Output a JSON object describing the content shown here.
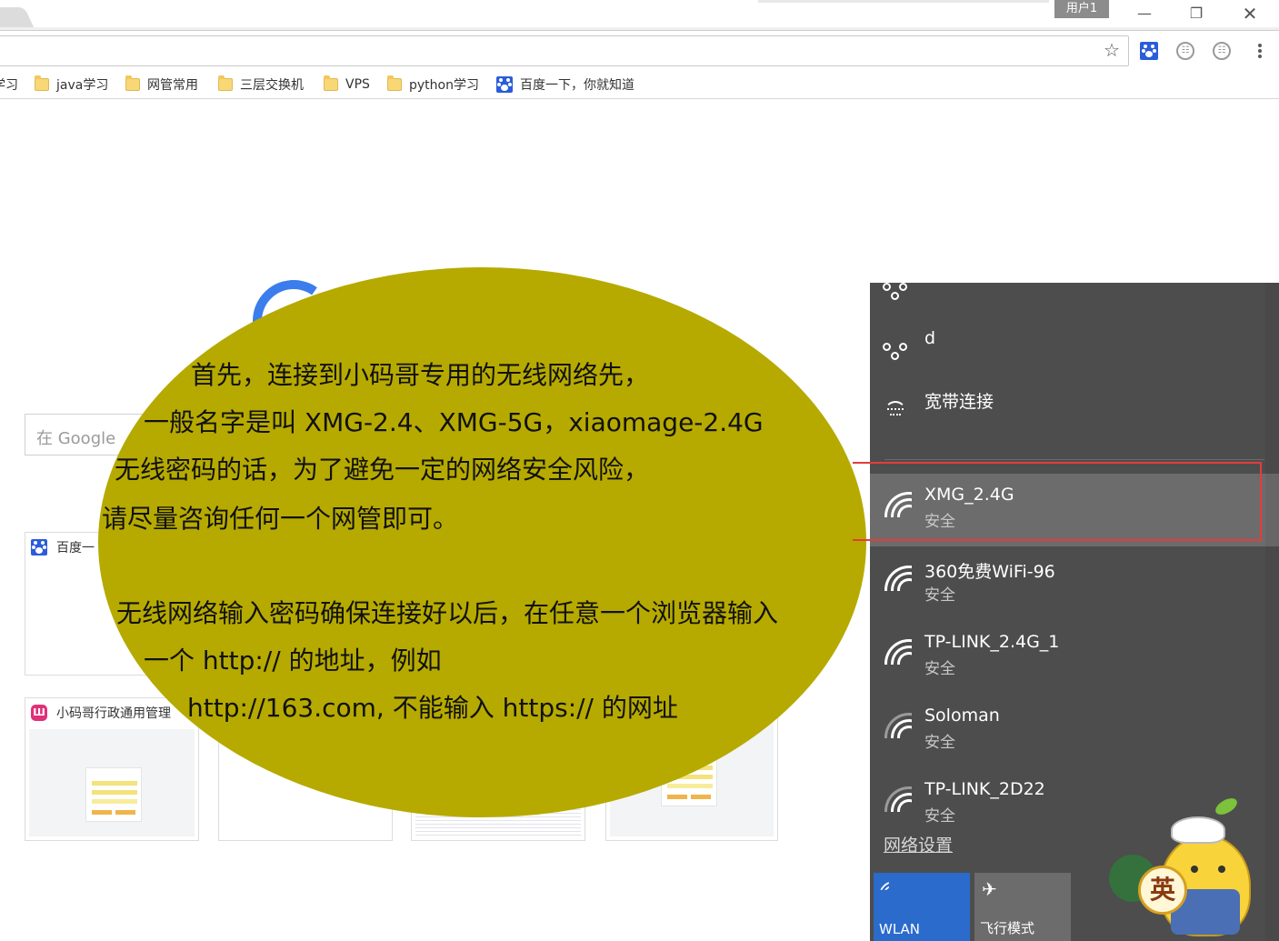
{
  "window": {
    "user_badge": "用户1",
    "min_glyph": "—",
    "max_glyph": "❐",
    "close_glyph": "✕"
  },
  "toolbar": {
    "star_glyph": "☆",
    "ext_circle_glyph": "☷"
  },
  "bookmarks": [
    {
      "label": "学习",
      "icon": "folder-icon"
    },
    {
      "label": "java学习",
      "icon": "folder-icon"
    },
    {
      "label": "网管常用",
      "icon": "folder-icon"
    },
    {
      "label": "三层交换机",
      "icon": "folder-icon"
    },
    {
      "label": "VPS",
      "icon": "folder-icon"
    },
    {
      "label": "python学习",
      "icon": "folder-icon"
    },
    {
      "label": "百度一下，你就知道",
      "icon": "baidu-paw-icon"
    }
  ],
  "newtab": {
    "search_placeholder": "在 Google",
    "tiles": [
      {
        "title": "百度一"
      },
      {
        "title": "小码哥行政通用管理"
      }
    ],
    "tile_logo": "Ш"
  },
  "bubble": {
    "lines": [
      "首先，连接到小码哥专用的无线网络先，",
      "一般名字是叫 XMG-2.4、XMG-5G，xiaomage-2.4G",
      "无线密码的话，为了避免一定的网络安全风险，",
      "请尽量咨询任何一个网管即可。",
      "无线网络输入密码确保连接好以后，在任意一个浏览器输入",
      "一个 http:// 的地址，例如",
      "http://163.com, 不能输入 https:// 的网址"
    ]
  },
  "wifi": {
    "dialups": [
      {
        "name": "d"
      }
    ],
    "broadband": {
      "name": "宽带连接"
    },
    "networks": [
      {
        "name": "XMG_2.4G",
        "status": "安全",
        "selected": true
      },
      {
        "name": "360免费WiFi-96",
        "status": "安全",
        "selected": false
      },
      {
        "name": "TP-LINK_2.4G_1",
        "status": "安全",
        "selected": false
      },
      {
        "name": "Soloman",
        "status": "安全",
        "selected": false
      },
      {
        "name": "TP-LINK_2D22",
        "status": "安全",
        "selected": false
      }
    ],
    "settings_link": "网络设置",
    "quick_actions": {
      "wlan": "WLAN",
      "airplane": "飞行模式",
      "airplane_glyph": "✈"
    }
  },
  "mascot": {
    "badge": "英"
  },
  "colors": {
    "bubble": "#b6aa00",
    "flyout_bg": "#4d4d4d",
    "selected_row": "#6c6c6c",
    "highlight_box": "#e43c3c",
    "wlan_tile": "#2a6bcc"
  }
}
